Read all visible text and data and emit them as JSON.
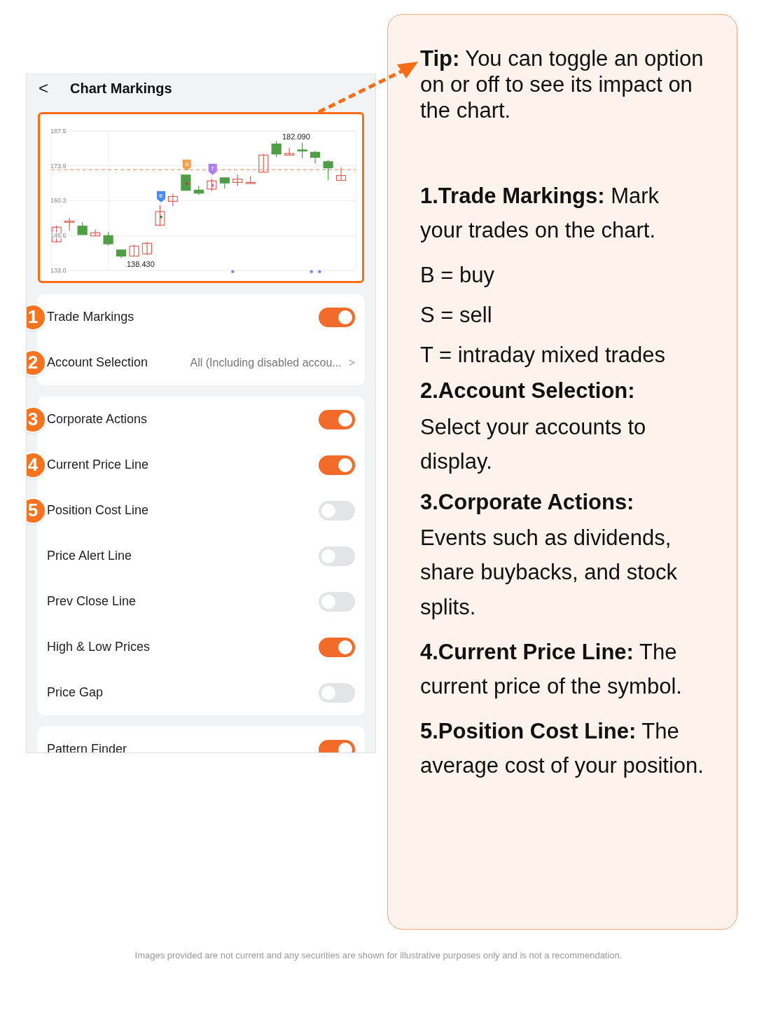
{
  "header": {
    "back": "<",
    "title": "Chart Markings"
  },
  "chart": {
    "high_label": "182.090",
    "low_label": "138.430",
    "chart_data": {
      "type": "candlestick",
      "ohlc": [
        [
          144.2,
          150.6,
          143.9,
          149.9
        ],
        [
          151.8,
          153.5,
          148.6,
          152.3
        ],
        [
          150.3,
          151.8,
          147.0,
          147.0
        ],
        [
          146.5,
          149.0,
          146.5,
          147.7
        ],
        [
          146.6,
          148.0,
          142.7,
          143.4
        ],
        [
          141.0,
          141.0,
          137.8,
          138.6
        ],
        [
          138.6,
          143.1,
          138.6,
          142.5
        ],
        [
          139.5,
          144.2,
          139.0,
          143.6
        ],
        [
          150.7,
          158.5,
          150.4,
          156.0
        ],
        [
          160.0,
          163.0,
          158.1,
          161.9
        ],
        [
          170.3,
          170.3,
          164.3,
          164.3
        ],
        [
          164.4,
          166.1,
          162.6,
          163.2
        ],
        [
          164.8,
          168.9,
          164.1,
          168.0
        ],
        [
          169.2,
          169.4,
          165.0,
          167.2
        ],
        [
          167.4,
          170.5,
          166.0,
          168.7
        ],
        [
          167.1,
          169.9,
          167.1,
          167.4
        ],
        [
          171.4,
          178.6,
          171.4,
          178.1
        ],
        [
          182.4,
          183.5,
          177.4,
          178.5
        ],
        [
          178.1,
          180.9,
          178.1,
          178.7
        ],
        [
          180.1,
          182.9,
          176.9,
          179.7
        ],
        [
          179.2,
          179.7,
          174.8,
          177.2
        ],
        [
          175.5,
          176.0,
          168.2,
          173.1
        ],
        [
          168.2,
          173.3,
          168.2,
          170.1
        ]
      ],
      "grid": true,
      "ref_lines": [
        {
          "axis": "y",
          "value": 172.4,
          "color": "#f08050"
        }
      ],
      "ylim": [
        133.0,
        187.5
      ],
      "yticks": [
        {
          "value": 187.5,
          "label": "187.5"
        },
        {
          "value": 173.9,
          "label": "173.9"
        },
        {
          "value": 160.3,
          "label": "160.3"
        },
        {
          "value": 146.6,
          "label": "146.6"
        },
        {
          "value": 133.0,
          "label": "133.0"
        }
      ]
    },
    "markers": [
      {
        "label": "B",
        "color": "#4a8af4"
      },
      {
        "label": "S",
        "color": "#f0a050"
      },
      {
        "label": "T",
        "color": "#b07ef0"
      }
    ]
  },
  "groups": [
    [
      {
        "kind": "toggle",
        "badge": "1",
        "label": "Trade Markings",
        "on": true
      },
      {
        "kind": "link",
        "badge": "2",
        "label": "Account Selection",
        "value": "All (Including disabled accou...",
        "chevron": ">"
      }
    ],
    [
      {
        "kind": "toggle",
        "badge": "3",
        "label": "Corporate Actions",
        "on": true
      },
      {
        "kind": "toggle",
        "badge": "4",
        "label": "Current Price Line",
        "on": true
      },
      {
        "kind": "toggle",
        "badge": "5",
        "label": "Position Cost Line",
        "on": false
      },
      {
        "kind": "toggle",
        "label": "Price Alert Line",
        "on": false
      },
      {
        "kind": "toggle",
        "label": "Prev Close Line",
        "on": false
      },
      {
        "kind": "toggle",
        "label": "High & Low Prices",
        "on": true
      },
      {
        "kind": "toggle",
        "label": "Price Gap",
        "on": false
      }
    ],
    [
      {
        "kind": "toggle",
        "label": "Pattern Finder",
        "on": true
      }
    ]
  ],
  "tip": {
    "text": "**Tip:** You can toggle an option on or off to see its impact on the chart."
  },
  "sections": [
    {
      "kind": "inline",
      "text": "**1.Trade Markings:** Mark your trades on the chart.",
      "lines": [
        "B = buy",
        "S = sell",
        "T = intraday mixed trades"
      ]
    },
    {
      "kind": "block",
      "heading": "2.Account Selection:",
      "text": "Select your accounts to display."
    },
    {
      "kind": "block",
      "heading": "3.Corporate Actions:",
      "text": "Events such as dividends, share buybacks, and stock splits."
    },
    {
      "kind": "inline",
      "text": "**4.Current Price Line:** The current price of the symbol."
    },
    {
      "kind": "inline",
      "text": "**5.Position Cost Line:** The average cost of your position."
    }
  ],
  "disclaimer": "Images provided are not current and any securities are shown for illustrative purposes only and is not a recommendation."
}
